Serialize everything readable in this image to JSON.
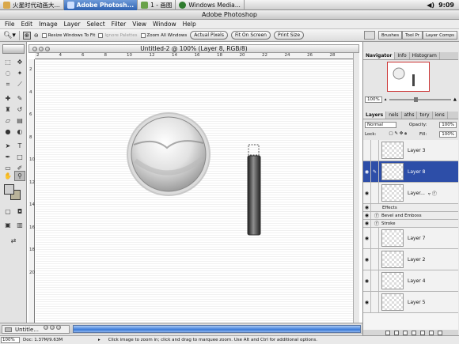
{
  "os_bar": {
    "tasks": [
      {
        "label": "火星时代动画大...",
        "active": false,
        "color": "#d9a84a"
      },
      {
        "label": "Adobe Photosh...",
        "active": true,
        "color": "#2e6fc4"
      },
      {
        "label": "1 - 画图",
        "active": false,
        "color": "#6aa24a"
      },
      {
        "label": "Windows Media...",
        "active": false,
        "color": "#2e7b2e"
      }
    ],
    "clock": "9:09"
  },
  "app_title": "Adobe Photoshop",
  "menu": [
    "File",
    "Edit",
    "Image",
    "Layer",
    "Select",
    "Filter",
    "View",
    "Window",
    "Help"
  ],
  "options": {
    "resize_windows": "Resize Windows To Fit",
    "ignore_palettes": "Ignore Palettes",
    "zoom_all": "Zoom All Windows",
    "actual_pixels": "Actual Pixels",
    "fit_on_screen": "Fit On Screen",
    "print_size": "Print Size"
  },
  "palette_well": [
    "Brushes",
    "Tool Pr",
    "Layer Comps"
  ],
  "document": {
    "title": "Untitled-2 @ 100% (Layer 8, RGB/8)",
    "ruler_h": [
      "2",
      "4",
      "6",
      "8",
      "10",
      "12",
      "14",
      "16",
      "18",
      "20",
      "22",
      "24",
      "26",
      "28"
    ],
    "ruler_v": [
      "2",
      "4",
      "6",
      "8",
      "10",
      "12",
      "14",
      "16",
      "18",
      "20"
    ]
  },
  "navigator": {
    "tabs": [
      "Navigator",
      "Info",
      "Histogram"
    ],
    "zoom": "100%"
  },
  "layers_panel": {
    "tabs": [
      "Layers",
      "nels",
      "aths",
      "tory",
      "ions"
    ],
    "blend_mode": "Normal",
    "opacity_label": "Opacity:",
    "opacity": "100%",
    "lock_label": "Lock:",
    "fill_label": "Fill:",
    "fill": "100%",
    "layers": [
      {
        "name": "Layer 3",
        "visible": false,
        "selected": false,
        "kind": "layer"
      },
      {
        "name": "Layer 8",
        "visible": true,
        "selected": true,
        "kind": "layer"
      },
      {
        "name": "Layer...",
        "visible": true,
        "selected": false,
        "kind": "layer-fx"
      },
      {
        "name": "Effects",
        "visible": true,
        "selected": false,
        "kind": "effect"
      },
      {
        "name": "Bevel and Emboss",
        "visible": true,
        "selected": false,
        "kind": "effect"
      },
      {
        "name": "Stroke",
        "visible": true,
        "selected": false,
        "kind": "effect"
      },
      {
        "name": "Layer 7",
        "visible": true,
        "selected": false,
        "kind": "layer"
      },
      {
        "name": "Layer 2",
        "visible": true,
        "selected": false,
        "kind": "layer"
      },
      {
        "name": "Layer 4",
        "visible": true,
        "selected": false,
        "kind": "layer"
      },
      {
        "name": "Layer 5",
        "visible": true,
        "selected": false,
        "kind": "layer"
      }
    ]
  },
  "minimized": {
    "label": "Untitle..."
  },
  "status": {
    "zoom": "100%",
    "doc_size": "Doc: 1.37M/9.63M",
    "hint": "Click image to zoom in; click and drag to marquee zoom.  Use Alt and Ctrl for additional options."
  }
}
